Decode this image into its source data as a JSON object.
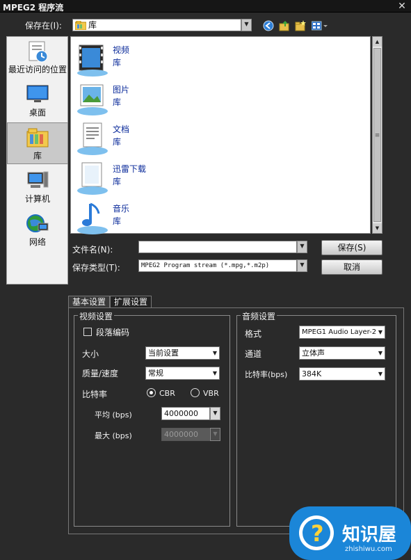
{
  "window": {
    "title": "MPEG2 程序流",
    "close_glyph": "✕"
  },
  "save_in": {
    "label": "保存在(I):",
    "value": "库"
  },
  "toolbar_icons": [
    "back-icon",
    "up-folder-icon",
    "new-folder-icon",
    "view-menu-icon"
  ],
  "places": [
    {
      "label": "最近访问的位置",
      "icon": "recent-places-icon"
    },
    {
      "label": "桌面",
      "icon": "desktop-icon"
    },
    {
      "label": "库",
      "icon": "libraries-icon",
      "selected": true
    },
    {
      "label": "计算机",
      "icon": "computer-icon"
    },
    {
      "label": "网络",
      "icon": "network-icon"
    }
  ],
  "files": [
    {
      "name": "视频",
      "type": "库",
      "icon": "video-library-icon"
    },
    {
      "name": "图片",
      "type": "库",
      "icon": "pictures-library-icon"
    },
    {
      "name": "文档",
      "type": "库",
      "icon": "documents-library-icon"
    },
    {
      "name": "迅雷下载",
      "type": "库",
      "icon": "downloads-library-icon"
    },
    {
      "name": "音乐",
      "type": "库",
      "icon": "music-library-icon"
    }
  ],
  "filename": {
    "label": "文件名(N):",
    "value": ""
  },
  "filetype": {
    "label": "保存类型(T):",
    "value": "MPEG2 Program stream (*.mpg,*.m2p)"
  },
  "buttons": {
    "save": "保存(S)",
    "cancel": "取消"
  },
  "tabs": [
    {
      "label": "基本设置",
      "active": true
    },
    {
      "label": "扩展设置",
      "active": false
    }
  ],
  "video": {
    "title": "视频设置",
    "segment_label": "段落编码",
    "segment_checked": false,
    "size_label": "大小",
    "size_value": "当前设置",
    "quality_label": "质量/速度",
    "quality_value": "常规",
    "bitrate_label": "比特率",
    "cbr_label": "CBR",
    "vbr_label": "VBR",
    "bitrate_mode": "CBR",
    "avg_label": "平均 (bps)",
    "avg_value": "4000000",
    "max_label": "最大 (bps)",
    "max_value": "4000000"
  },
  "audio": {
    "title": "音频设置",
    "format_label": "格式",
    "format_value": "MPEG1 Audio Layer-2",
    "channel_label": "通道",
    "channel_value": "立体声",
    "bitrate_label": "比特率(bps)",
    "bitrate_value": "384K"
  },
  "watermark": {
    "brand": "知识屋",
    "url": "zhishiwu.com"
  }
}
